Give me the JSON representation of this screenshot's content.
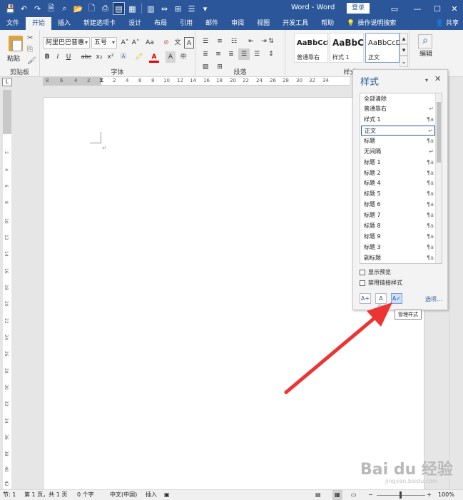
{
  "titlebar": {
    "title": "Word - Word",
    "login": "登录",
    "minimize": "—",
    "restore": "☐",
    "close": "✕"
  },
  "qat_icons": [
    "save-icon",
    "undo-icon",
    "redo-icon",
    "print-preview-icon",
    "find-icon",
    "open-icon",
    "new-doc-icon",
    "print-icon",
    "page-view-icon",
    "layout-icon",
    "columns-icon",
    "margins-icon",
    "table-icon",
    "bullets-icon",
    "customize-icon"
  ],
  "tabs": [
    "文件",
    "开始",
    "插入",
    "新建选项卡",
    "设计",
    "布局",
    "引用",
    "邮件",
    "审阅",
    "视图",
    "开发工具",
    "帮助"
  ],
  "active_tab": "开始",
  "tell_me": "操作说明搜索",
  "share": "共享",
  "ribbon": {
    "clipboard": {
      "paste": "粘贴",
      "label": "剪贴板"
    },
    "font": {
      "font_name": "阿里巴巴普惠",
      "font_size": "五号",
      "bold": "B",
      "italic": "I",
      "underline": "U",
      "strike": "abc",
      "sub": "x₂",
      "sup": "x²",
      "grow": "A˄",
      "shrink": "A˅",
      "case": "Aa",
      "phonetic": "文",
      "border": "A",
      "color": "A",
      "clear": "⊘",
      "label": "字体"
    },
    "paragraph": {
      "label": "段落"
    },
    "styles": {
      "label": "样式",
      "gallery": [
        {
          "sample": "AaBbCcI",
          "name": "普通靠右"
        },
        {
          "sample": "AaBbC",
          "name": "样式 1"
        },
        {
          "sample": "AaBbCcDc",
          "name": "正文"
        }
      ]
    },
    "editing": {
      "label": "编辑"
    }
  },
  "hruler_ticks": [
    "8",
    "6",
    "4",
    "2",
    "2",
    "4",
    "6",
    "8",
    "10",
    "12",
    "14",
    "16",
    "18",
    "20",
    "22",
    "24",
    "26",
    "28",
    "30",
    "32",
    "34"
  ],
  "vruler_ticks": [
    "2",
    "4",
    "6",
    "8",
    "10",
    "12",
    "14",
    "16",
    "18",
    "20",
    "22",
    "24",
    "26",
    "28",
    "30",
    "32",
    "34",
    "36",
    "38",
    "40",
    "42"
  ],
  "styles_pane": {
    "title": "样式",
    "items": [
      {
        "name": "全部清除",
        "mark": ""
      },
      {
        "name": "普通靠右",
        "mark": "↵"
      },
      {
        "name": "样式 1",
        "mark": "¶a"
      },
      {
        "name": "正文",
        "mark": "↵",
        "selected": true
      },
      {
        "name": "标题",
        "mark": "¶a"
      },
      {
        "name": "无间隔",
        "mark": "↵"
      },
      {
        "name": "标题 1",
        "mark": "¶a"
      },
      {
        "name": "标题 2",
        "mark": "¶a"
      },
      {
        "name": "标题 4",
        "mark": "¶a"
      },
      {
        "name": "标题 5",
        "mark": "¶a"
      },
      {
        "name": "标题 6",
        "mark": "¶a"
      },
      {
        "name": "标题 7",
        "mark": "¶a"
      },
      {
        "name": "标题 8",
        "mark": "¶a"
      },
      {
        "name": "标题 9",
        "mark": "¶a"
      },
      {
        "name": "标题 3",
        "mark": "¶a"
      },
      {
        "name": "副标题",
        "mark": "¶a"
      }
    ],
    "show_preview": "显示预览",
    "disable_linked": "禁用链接样式",
    "options": "选项...",
    "tooltip": "管理样式"
  },
  "statusbar": {
    "section": "节: 1",
    "page": "第 1 页，共 1 页",
    "words": "0 个字",
    "lang": "中文(中国)",
    "mode": "插入",
    "zoom": "100%"
  },
  "watermark": {
    "brand": "Bai du 经验",
    "sub": "jingyan.baidu.com"
  },
  "colors": {
    "accent": "#2b579a",
    "arrow": "#ee3333"
  }
}
